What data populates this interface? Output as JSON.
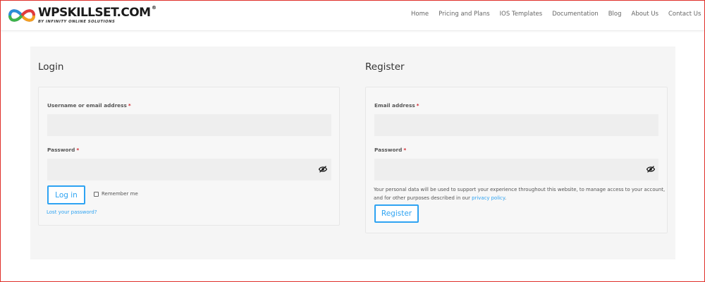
{
  "site": {
    "logo_name": "WPSKILLSET.COM",
    "logo_reg": "®",
    "logo_tagline": "BY INFINITY ONLINE SOLUTIONS"
  },
  "nav": {
    "items": [
      {
        "label": "Home"
      },
      {
        "label": "Pricing and Plans"
      },
      {
        "label": "IOS Templates"
      },
      {
        "label": "Documentation"
      },
      {
        "label": "Blog"
      },
      {
        "label": "About Us"
      },
      {
        "label": "Contact Us"
      }
    ],
    "cart_icon": "cart-icon",
    "search_icon": "search-icon"
  },
  "login": {
    "title": "Login",
    "username_label": "Username or email address",
    "username_value": "",
    "password_label": "Password",
    "password_value": "",
    "required_mark": "*",
    "submit_label": "Log in",
    "remember_label": "Remember me",
    "remember_checked": false,
    "lost_password": "Lost your password?"
  },
  "register": {
    "title": "Register",
    "email_label": "Email address",
    "email_value": "",
    "password_label": "Password",
    "password_value": "",
    "required_mark": "*",
    "privacy_text": "Your personal data will be used to support your experience throughout this website, to manage access to your account, and for other purposes described in our",
    "privacy_link": "privacy policy",
    "privacy_end": ".",
    "submit_label": "Register"
  },
  "colors": {
    "accent": "#2ea3f2",
    "required": "#d0212a",
    "panel_bg": "#f5f5f5",
    "input_bg": "#eeeeee"
  }
}
